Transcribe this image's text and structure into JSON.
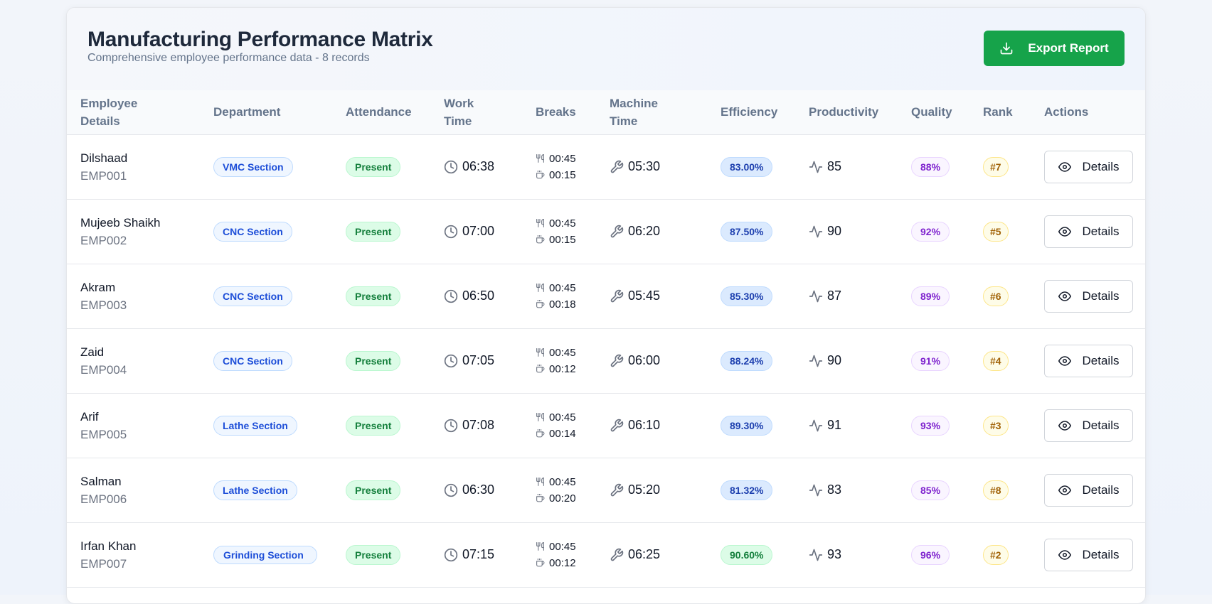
{
  "header": {
    "title": "Manufacturing Performance Matrix",
    "subtitle": "Comprehensive employee performance data - 8 records",
    "export_label": "Export Report"
  },
  "columns": [
    "Employee Details",
    "Department",
    "Attendance",
    "Work Time",
    "Breaks",
    "Machine Time",
    "Efficiency",
    "Productivity",
    "Quality",
    "Rank",
    "Actions"
  ],
  "details_label": "Details",
  "rows": [
    {
      "name": "Dilshaad",
      "id": "EMP001",
      "department": "VMC Section",
      "attendance": "Present",
      "work_time": "06:38",
      "meal_break": "00:45",
      "tea_break": "00:15",
      "machine_time": "05:30",
      "efficiency": "83.00%",
      "productivity": "85",
      "quality": "88%",
      "rank": "#7"
    },
    {
      "name": "Mujeeb Shaikh",
      "id": "EMP002",
      "department": "CNC Section",
      "attendance": "Present",
      "work_time": "07:00",
      "meal_break": "00:45",
      "tea_break": "00:15",
      "machine_time": "06:20",
      "efficiency": "87.50%",
      "productivity": "90",
      "quality": "92%",
      "rank": "#5"
    },
    {
      "name": "Akram",
      "id": "EMP003",
      "department": "CNC Section",
      "attendance": "Present",
      "work_time": "06:50",
      "meal_break": "00:45",
      "tea_break": "00:18",
      "machine_time": "05:45",
      "efficiency": "85.30%",
      "productivity": "87",
      "quality": "89%",
      "rank": "#6"
    },
    {
      "name": "Zaid",
      "id": "EMP004",
      "department": "CNC Section",
      "attendance": "Present",
      "work_time": "07:05",
      "meal_break": "00:45",
      "tea_break": "00:12",
      "machine_time": "06:00",
      "efficiency": "88.24%",
      "productivity": "90",
      "quality": "91%",
      "rank": "#4"
    },
    {
      "name": "Arif",
      "id": "EMP005",
      "department": "Lathe Section",
      "attendance": "Present",
      "work_time": "07:08",
      "meal_break": "00:45",
      "tea_break": "00:14",
      "machine_time": "06:10",
      "efficiency": "89.30%",
      "productivity": "91",
      "quality": "93%",
      "rank": "#3"
    },
    {
      "name": "Salman",
      "id": "EMP006",
      "department": "Lathe Section",
      "attendance": "Present",
      "work_time": "06:30",
      "meal_break": "00:45",
      "tea_break": "00:20",
      "machine_time": "05:20",
      "efficiency": "81.32%",
      "productivity": "83",
      "quality": "85%",
      "rank": "#8"
    },
    {
      "name": "Irfan Khan",
      "id": "EMP007",
      "department": "Grinding Section",
      "attendance": "Present",
      "work_time": "07:15",
      "meal_break": "00:45",
      "tea_break": "00:12",
      "machine_time": "06:25",
      "efficiency": "90.60%",
      "productivity": "93",
      "quality": "96%",
      "rank": "#2"
    }
  ],
  "colors": {
    "export_button": "#16a34a",
    "efficiency_high": "#dcfce7",
    "efficiency_normal": "#dbeafe"
  },
  "icons": {
    "export": "download-icon",
    "work_time": "clock-icon",
    "meal_break": "utensils-icon",
    "tea_break": "coffee-icon",
    "machine_time": "wrench-icon",
    "productivity": "activity-icon",
    "details": "eye-icon"
  }
}
